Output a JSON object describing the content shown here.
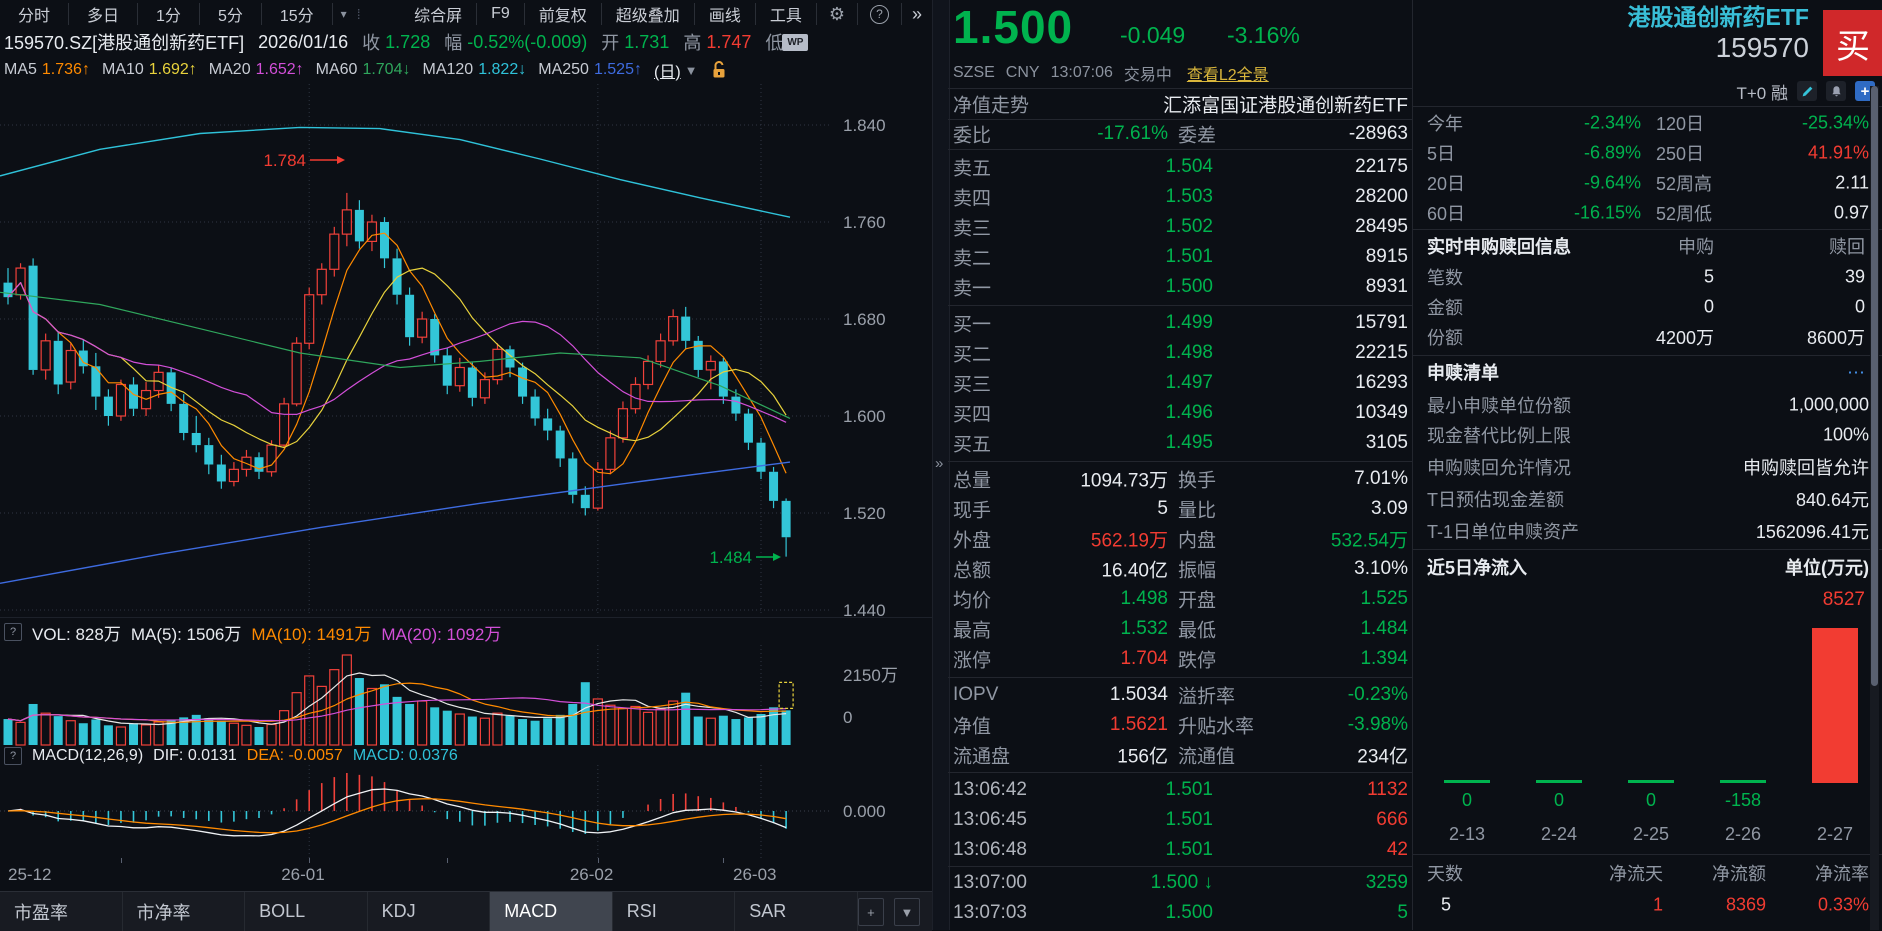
{
  "colors": {
    "green": "#00b34e",
    "red": "#f23c32",
    "white": "#e8ebf0",
    "gray": "#9097a3",
    "yellow": "#e8d23c",
    "cyan": "#39bfd8",
    "orange": "#ff8a00",
    "magenta": "#d24fd8",
    "blue": "#3e6be0",
    "link_yellow": "#d9b63c",
    "candle_up": "#f0413a",
    "candle_down": "#33c6d8",
    "ma5": "#ff8a00",
    "ma10": "#e8d23c",
    "ma20": "#d24fd8",
    "ma60": "#2fa65c",
    "ma120": "#2fc2d9",
    "ma250": "#3e6be0",
    "grid": "#2f3542",
    "axis_text": "#9aa0aa",
    "buy_red": "#d0282a",
    "lock_orange": "#e8a23c"
  },
  "toolbar": {
    "view_tabs": [
      "分时",
      "多日",
      "1分",
      "5分",
      "15分"
    ],
    "caret_icon": "▾",
    "dots_icon": "⁞",
    "tools": [
      "综合屏",
      "F9",
      "前复权",
      "超级叠加",
      "画线",
      "工具"
    ],
    "gear_icon": "⚙",
    "help_icon": "?",
    "expand_icon": "»"
  },
  "info_row": {
    "code_name": "159570.SZ[港股通创新药ETF]",
    "date": "2026/01/16",
    "fields": [
      {
        "label": "收",
        "value": "1.728",
        "color": "green"
      },
      {
        "label": "幅",
        "value": "-0.52%(-0.009)",
        "color": "green"
      },
      {
        "label": "开",
        "value": "1.731",
        "color": "green"
      },
      {
        "label": "高",
        "value": "1.747",
        "color": "red"
      },
      {
        "label": "低",
        "value": "",
        "color": "green"
      }
    ],
    "wp_badge": "WP"
  },
  "ma_row": {
    "items": [
      {
        "label": "MA5",
        "value": "1.736",
        "arrow": "↑",
        "color": "orange"
      },
      {
        "label": "MA10",
        "value": "1.692",
        "arrow": "↑",
        "color": "yellow"
      },
      {
        "label": "MA20",
        "value": "1.652",
        "arrow": "↑",
        "color": "magenta"
      },
      {
        "label": "MA60",
        "value": "1.704",
        "arrow": "↓",
        "color": "ma60"
      },
      {
        "label": "MA120",
        "value": "1.822",
        "arrow": "↓",
        "color": "ma120"
      },
      {
        "label": "MA250",
        "value": "1.525",
        "arrow": "↑",
        "color": "blue"
      }
    ],
    "period": "(日)",
    "period_caret": "▼"
  },
  "chart": {
    "price_axis": [
      {
        "label": "1.840",
        "p": 1.84
      },
      {
        "label": "1.760",
        "p": 1.76
      },
      {
        "label": "1.680",
        "p": 1.68
      },
      {
        "label": "1.600",
        "p": 1.6
      },
      {
        "label": "1.520",
        "p": 1.52
      },
      {
        "label": "1.440",
        "p": 1.44
      }
    ],
    "annotation_high": "1.784",
    "annotation_low": "1.484",
    "x_labels": [
      {
        "t": "25-12",
        "i": 0,
        "anchor": "start"
      },
      {
        "t": "26-01",
        "i": 24,
        "anchor": "middle"
      },
      {
        "t": "26-02",
        "i": 47,
        "anchor": "middle"
      },
      {
        "t": "26-03",
        "i": 60,
        "anchor": "middle"
      }
    ],
    "month_grid_idx": [
      24,
      47,
      60
    ],
    "tick_idx": [
      9,
      24,
      35,
      47,
      57
    ],
    "vol_pane": {
      "help": "?",
      "vol": "VOL: 828万",
      "ma5": "MA(5): 1506万",
      "ma10": "MA(10): 1491万",
      "ma20": "MA(20): 1092万",
      "axis_top": "2150万",
      "axis_zero": "0"
    },
    "macd_pane": {
      "help": "?",
      "name": "MACD(12,26,9)",
      "dif": "DIF: 0.0131",
      "dea": "DEA: -0.0057",
      "macd": "MACD: 0.0376",
      "axis_zero": "0.000"
    },
    "indicator_tabs": [
      "市盈率",
      "市净率",
      "BOLL",
      "KDJ",
      "MACD",
      "RSI",
      "SAR"
    ],
    "active_tab": "MACD",
    "add_button": "+",
    "collapse_button": "▼"
  },
  "chart_data": {
    "type": "candlestick",
    "note": "OHLC values estimated from pixels; daily candles Dec 2025 - Mar 2026",
    "price_range": [
      1.44,
      1.84
    ],
    "vol_axis_max_wan": 2150,
    "candles": [
      [
        1.71,
        1.722,
        1.692,
        1.698
      ],
      [
        1.7,
        1.726,
        1.696,
        1.722
      ],
      [
        1.724,
        1.73,
        1.634,
        1.638
      ],
      [
        1.638,
        1.668,
        1.63,
        1.662
      ],
      [
        1.662,
        1.67,
        1.618,
        1.626
      ],
      [
        1.628,
        1.66,
        1.622,
        1.654
      ],
      [
        1.654,
        1.663,
        1.635,
        1.641
      ],
      [
        1.641,
        1.652,
        1.605,
        1.616
      ],
      [
        1.616,
        1.622,
        1.592,
        1.6
      ],
      [
        1.6,
        1.63,
        1.596,
        1.626
      ],
      [
        1.626,
        1.632,
        1.6,
        1.606
      ],
      [
        1.606,
        1.628,
        1.6,
        1.621
      ],
      [
        1.621,
        1.642,
        1.615,
        1.636
      ],
      [
        1.636,
        1.64,
        1.604,
        1.61
      ],
      [
        1.61,
        1.618,
        1.58,
        1.586
      ],
      [
        1.586,
        1.6,
        1.57,
        1.576
      ],
      [
        1.576,
        1.582,
        1.552,
        1.56
      ],
      [
        1.56,
        1.568,
        1.54,
        1.546
      ],
      [
        1.546,
        1.562,
        1.542,
        1.556
      ],
      [
        1.556,
        1.572,
        1.55,
        1.566
      ],
      [
        1.566,
        1.57,
        1.548,
        1.554
      ],
      [
        1.554,
        1.58,
        1.55,
        1.576
      ],
      [
        1.576,
        1.615,
        1.574,
        1.61
      ],
      [
        1.61,
        1.665,
        1.608,
        1.66
      ],
      [
        1.66,
        1.706,
        1.655,
        1.7
      ],
      [
        1.7,
        1.726,
        1.692,
        1.721
      ],
      [
        1.721,
        1.756,
        1.715,
        1.75
      ],
      [
        1.75,
        1.784,
        1.74,
        1.77
      ],
      [
        1.77,
        1.778,
        1.738,
        1.744
      ],
      [
        1.744,
        1.766,
        1.736,
        1.76
      ],
      [
        1.76,
        1.764,
        1.722,
        1.73
      ],
      [
        1.73,
        1.738,
        1.692,
        1.7
      ],
      [
        1.7,
        1.706,
        1.658,
        1.665
      ],
      [
        1.665,
        1.686,
        1.66,
        1.68
      ],
      [
        1.68,
        1.684,
        1.644,
        1.65
      ],
      [
        1.65,
        1.656,
        1.618,
        1.625
      ],
      [
        1.625,
        1.648,
        1.62,
        1.64
      ],
      [
        1.64,
        1.644,
        1.608,
        1.615
      ],
      [
        1.615,
        1.636,
        1.61,
        1.63
      ],
      [
        1.63,
        1.66,
        1.626,
        1.655
      ],
      [
        1.655,
        1.658,
        1.632,
        1.64
      ],
      [
        1.64,
        1.644,
        1.61,
        1.616
      ],
      [
        1.616,
        1.622,
        1.592,
        1.598
      ],
      [
        1.598,
        1.606,
        1.58,
        1.588
      ],
      [
        1.588,
        1.592,
        1.558,
        1.565
      ],
      [
        1.565,
        1.57,
        1.528,
        1.535
      ],
      [
        1.535,
        1.542,
        1.518,
        1.524
      ],
      [
        1.524,
        1.562,
        1.522,
        1.556
      ],
      [
        1.556,
        1.588,
        1.552,
        1.582
      ],
      [
        1.582,
        1.612,
        1.578,
        1.606
      ],
      [
        1.606,
        1.632,
        1.602,
        1.626
      ],
      [
        1.626,
        1.65,
        1.622,
        1.645
      ],
      [
        1.645,
        1.668,
        1.64,
        1.662
      ],
      [
        1.662,
        1.688,
        1.658,
        1.682
      ],
      [
        1.682,
        1.69,
        1.655,
        1.662
      ],
      [
        1.662,
        1.666,
        1.632,
        1.638
      ],
      [
        1.638,
        1.65,
        1.622,
        1.645
      ],
      [
        1.645,
        1.648,
        1.61,
        1.616
      ],
      [
        1.616,
        1.622,
        1.596,
        1.602
      ],
      [
        1.602,
        1.606,
        1.572,
        1.578
      ],
      [
        1.578,
        1.582,
        1.548,
        1.554
      ],
      [
        1.554,
        1.558,
        1.524,
        1.53
      ],
      [
        1.53,
        1.532,
        1.484,
        1.5
      ]
    ],
    "volumes_wan": [
      620,
      540,
      980,
      760,
      690,
      580,
      520,
      610,
      470,
      430,
      520,
      480,
      550,
      600,
      660,
      720,
      640,
      580,
      520,
      470,
      430,
      490,
      820,
      1250,
      1650,
      1400,
      1800,
      2150,
      1600,
      1350,
      1450,
      1150,
      980,
      1050,
      900,
      820,
      740,
      680,
      640,
      760,
      700,
      620,
      580,
      640,
      720,
      980,
      1500,
      1100,
      950,
      870,
      920,
      780,
      860,
      1050,
      1250,
      680,
      640,
      700,
      620,
      660,
      740,
      900,
      828
    ],
    "ma60_path": [
      [
        0,
        1.702
      ],
      [
        100,
        1.692
      ],
      [
        200,
        1.672
      ],
      [
        300,
        1.652
      ],
      [
        400,
        1.64
      ],
      [
        480,
        1.645
      ],
      [
        560,
        1.652
      ],
      [
        640,
        1.648
      ],
      [
        720,
        1.625
      ],
      [
        790,
        1.598
      ]
    ],
    "ma120_path": [
      [
        0,
        1.798
      ],
      [
        100,
        1.82
      ],
      [
        200,
        1.833
      ],
      [
        300,
        1.838
      ],
      [
        380,
        1.837
      ],
      [
        460,
        1.828
      ],
      [
        540,
        1.812
      ],
      [
        620,
        1.795
      ],
      [
        700,
        1.78
      ],
      [
        790,
        1.764
      ]
    ],
    "ma250_path": [
      [
        0,
        1.462
      ],
      [
        160,
        1.486
      ],
      [
        320,
        1.508
      ],
      [
        480,
        1.528
      ],
      [
        640,
        1.546
      ],
      [
        790,
        1.562
      ]
    ]
  },
  "quote": {
    "price": "1.500",
    "change": "-0.049",
    "pct": "-3.16%",
    "exchange": "SZSE",
    "currency": "CNY",
    "time": "13:07:06",
    "status": "交易中",
    "l2_link": "查看L2全景",
    "name": "港股通创新药ETF",
    "code": "159570",
    "buy_button": "买",
    "trade_tags": "T+0 融"
  },
  "fund_row": {
    "label": "净值走势",
    "value": "汇添富国证港股通创新药ETF"
  },
  "weibi_row": {
    "label1": "委比",
    "value1": "-17.61%",
    "label2": "委差",
    "value2": "-28963"
  },
  "order_book": {
    "asks": [
      {
        "label": "卖五",
        "price": "1.504",
        "vol": "22175"
      },
      {
        "label": "卖四",
        "price": "1.503",
        "vol": "28200"
      },
      {
        "label": "卖三",
        "price": "1.502",
        "vol": "28495"
      },
      {
        "label": "卖二",
        "price": "1.501",
        "vol": "8915"
      },
      {
        "label": "卖一",
        "price": "1.500",
        "vol": "8931"
      }
    ],
    "bids": [
      {
        "label": "买一",
        "price": "1.499",
        "vol": "15791"
      },
      {
        "label": "买二",
        "price": "1.498",
        "vol": "22215"
      },
      {
        "label": "买三",
        "price": "1.497",
        "vol": "16293"
      },
      {
        "label": "买四",
        "price": "1.496",
        "vol": "10349"
      },
      {
        "label": "买五",
        "price": "1.495",
        "vol": "3105"
      }
    ]
  },
  "stats_a": [
    {
      "l1": "总量",
      "v1": "1094.73万",
      "c1": "white",
      "l2": "换手",
      "v2": "7.01%",
      "c2": "white"
    },
    {
      "l1": "现手",
      "v1": "5",
      "c1": "white",
      "l2": "量比",
      "v2": "3.09",
      "c2": "white"
    },
    {
      "l1": "外盘",
      "v1": "562.19万",
      "c1": "red",
      "l2": "内盘",
      "v2": "532.54万",
      "c2": "green"
    },
    {
      "l1": "总额",
      "v1": "16.40亿",
      "c1": "white",
      "l2": "振幅",
      "v2": "3.10%",
      "c2": "white"
    },
    {
      "l1": "均价",
      "v1": "1.498",
      "c1": "green",
      "l2": "开盘",
      "v2": "1.525",
      "c2": "green"
    },
    {
      "l1": "最高",
      "v1": "1.532",
      "c1": "green",
      "l2": "最低",
      "v2": "1.484",
      "c2": "green"
    },
    {
      "l1": "涨停",
      "v1": "1.704",
      "c1": "red",
      "l2": "跌停",
      "v2": "1.394",
      "c2": "green"
    }
  ],
  "stats_b": [
    {
      "l1": "IOPV",
      "v1": "1.5034",
      "c1": "white",
      "l2": "溢折率",
      "v2": "-0.23%",
      "c2": "green"
    },
    {
      "l1": "净值",
      "v1": "1.5621",
      "c1": "red",
      "l2": "升贴水率",
      "v2": "-3.98%",
      "c2": "green"
    },
    {
      "l1": "流通盘",
      "v1": "156亿",
      "c1": "white",
      "l2": "流通值",
      "v2": "234亿",
      "c2": "white"
    }
  ],
  "ticks": [
    {
      "time": "13:06:42",
      "price": "1.501",
      "arrow": "",
      "vol": "1132",
      "vol_color": "red"
    },
    {
      "time": "13:06:45",
      "price": "1.501",
      "arrow": "",
      "vol": "666",
      "vol_color": "red"
    },
    {
      "time": "13:06:48",
      "price": "1.501",
      "arrow": "",
      "vol": "42",
      "vol_color": "red"
    },
    {
      "time": "13:07:00",
      "price": "1.500",
      "arrow": "↓",
      "vol": "3259",
      "vol_color": "green"
    },
    {
      "time": "13:07:03",
      "price": "1.500",
      "arrow": "",
      "vol": "5",
      "vol_color": "green"
    }
  ],
  "perf": [
    {
      "l1": "今年",
      "v1": "-2.34%",
      "c1": "green",
      "l2": "120日",
      "v2": "-25.34%",
      "c2": "green"
    },
    {
      "l1": "5日",
      "v1": "-6.89%",
      "c1": "green",
      "l2": "250日",
      "v2": "41.91%",
      "c2": "red"
    },
    {
      "l1": "20日",
      "v1": "-9.64%",
      "c1": "green",
      "l2": "52周高",
      "v2": "2.11",
      "c2": "white"
    },
    {
      "l1": "60日",
      "v1": "-16.15%",
      "c1": "green",
      "l2": "52周低",
      "v2": "0.97",
      "c2": "white"
    }
  ],
  "subscription": {
    "header": "实时申购赎回信息",
    "col1": "申购",
    "col2": "赎回",
    "rows": [
      {
        "label": "笔数",
        "v1": "5",
        "v2": "39"
      },
      {
        "label": "金额",
        "v1": "0",
        "v2": "0"
      },
      {
        "label": "份额",
        "v1": "4200万",
        "v2": "8600万"
      }
    ]
  },
  "redeem": {
    "header": "申赎清单",
    "more": "···",
    "rows": [
      {
        "label": "最小申赎单位份额",
        "value": "1,000,000"
      },
      {
        "label": "现金替代比例上限",
        "value": "100%"
      },
      {
        "label": "申购赎回允许情况",
        "value": "申购赎回皆允许"
      },
      {
        "label": "T日预估现金差额",
        "value": "840.64元"
      },
      {
        "label": "T-1日单位申赎资产",
        "value": "1562096.41元"
      }
    ]
  },
  "netflow": {
    "header": "近5日净流入",
    "unit": "单位(万元)",
    "peak_label": "8527",
    "bars": [
      {
        "date": "2-13",
        "value": 0,
        "label": "0"
      },
      {
        "date": "2-24",
        "value": 0,
        "label": "0"
      },
      {
        "date": "2-25",
        "value": 0,
        "label": "0"
      },
      {
        "date": "2-26",
        "value": -158,
        "label": "-158"
      },
      {
        "date": "2-27",
        "value": 8527,
        "label": ""
      }
    ],
    "summary": [
      {
        "label": "天数",
        "value": "5",
        "color": "white"
      },
      {
        "label": "净流天",
        "value": "1",
        "color": "red"
      },
      {
        "label": "净流额",
        "value": "8369",
        "color": "red"
      },
      {
        "label": "净流率",
        "value": "0.33%",
        "color": "red"
      }
    ]
  }
}
